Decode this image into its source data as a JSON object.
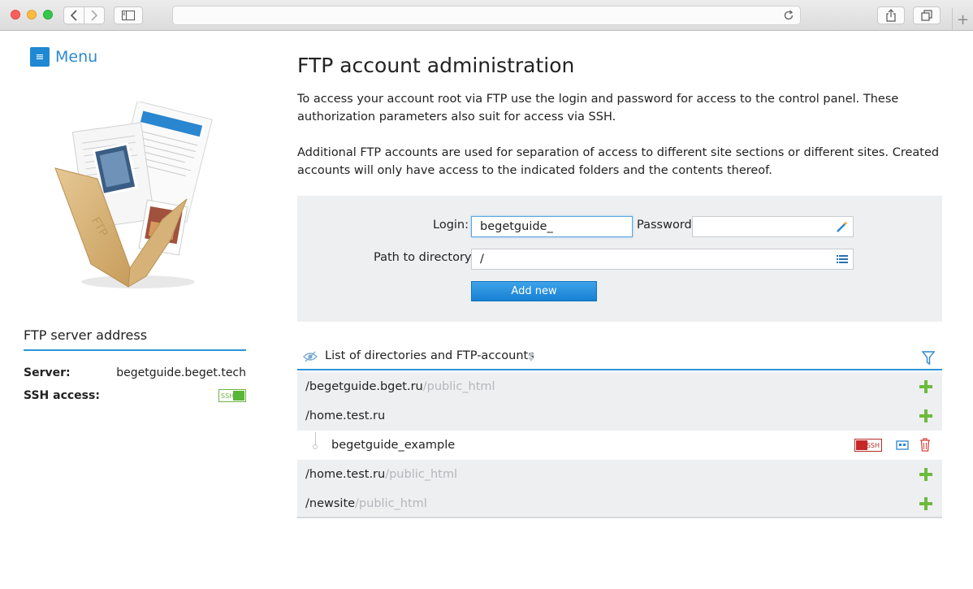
{
  "menu": {
    "label": "Menu"
  },
  "page": {
    "title": "FTP account administration",
    "intro_1": "To access your account root via FTP use the login and password for access to the control panel. These authorization parameters also suit for access via SSH.",
    "intro_2": "Additional FTP accounts are used for separation of access to different site sections or different sites. Created accounts will only have access to the indicated folders and the contents thereof."
  },
  "form": {
    "login_label": "Login:",
    "login_value": "begetguide_",
    "password_label": "Password",
    "password_value": "",
    "path_label": "Path to directory:",
    "path_value": "/",
    "add_button": "Add new"
  },
  "server_info": {
    "heading": "FTP server address",
    "server_label": "Server:",
    "server_value": "begetguide.beget.tech",
    "ssh_label": "SSH access:",
    "ssh_toggle_text": "SSH",
    "ssh_enabled": true
  },
  "list": {
    "title": "List of directories and FTP-accounts",
    "rows": [
      {
        "path": "/begetguide.bget.ru",
        "suffix": "/public_html"
      },
      {
        "path": "/home.test.ru",
        "suffix": ""
      },
      {
        "account": "begetguide_example",
        "ssh_text": "SSH",
        "ssh_enabled": false
      },
      {
        "path": "/home.test.ru",
        "suffix": "/public_html"
      },
      {
        "path": "/newsite",
        "suffix": "/public_html"
      }
    ]
  },
  "colors": {
    "accent": "#2b95d6",
    "button": "#1e88d4",
    "ssh_on": "#59b53a",
    "ssh_off": "#c62828",
    "plus": "#6cbb3c",
    "row_bg": "#eeeff1"
  },
  "icons": [
    "back-icon",
    "forward-icon",
    "sidebar-icon",
    "reload-icon",
    "share-icon",
    "tabs-icon",
    "menu-icon",
    "magic-wand-icon",
    "list-icon",
    "eye-icon",
    "sort-icon",
    "filter-icon",
    "plus-icon",
    "card-icon",
    "trash-icon"
  ]
}
